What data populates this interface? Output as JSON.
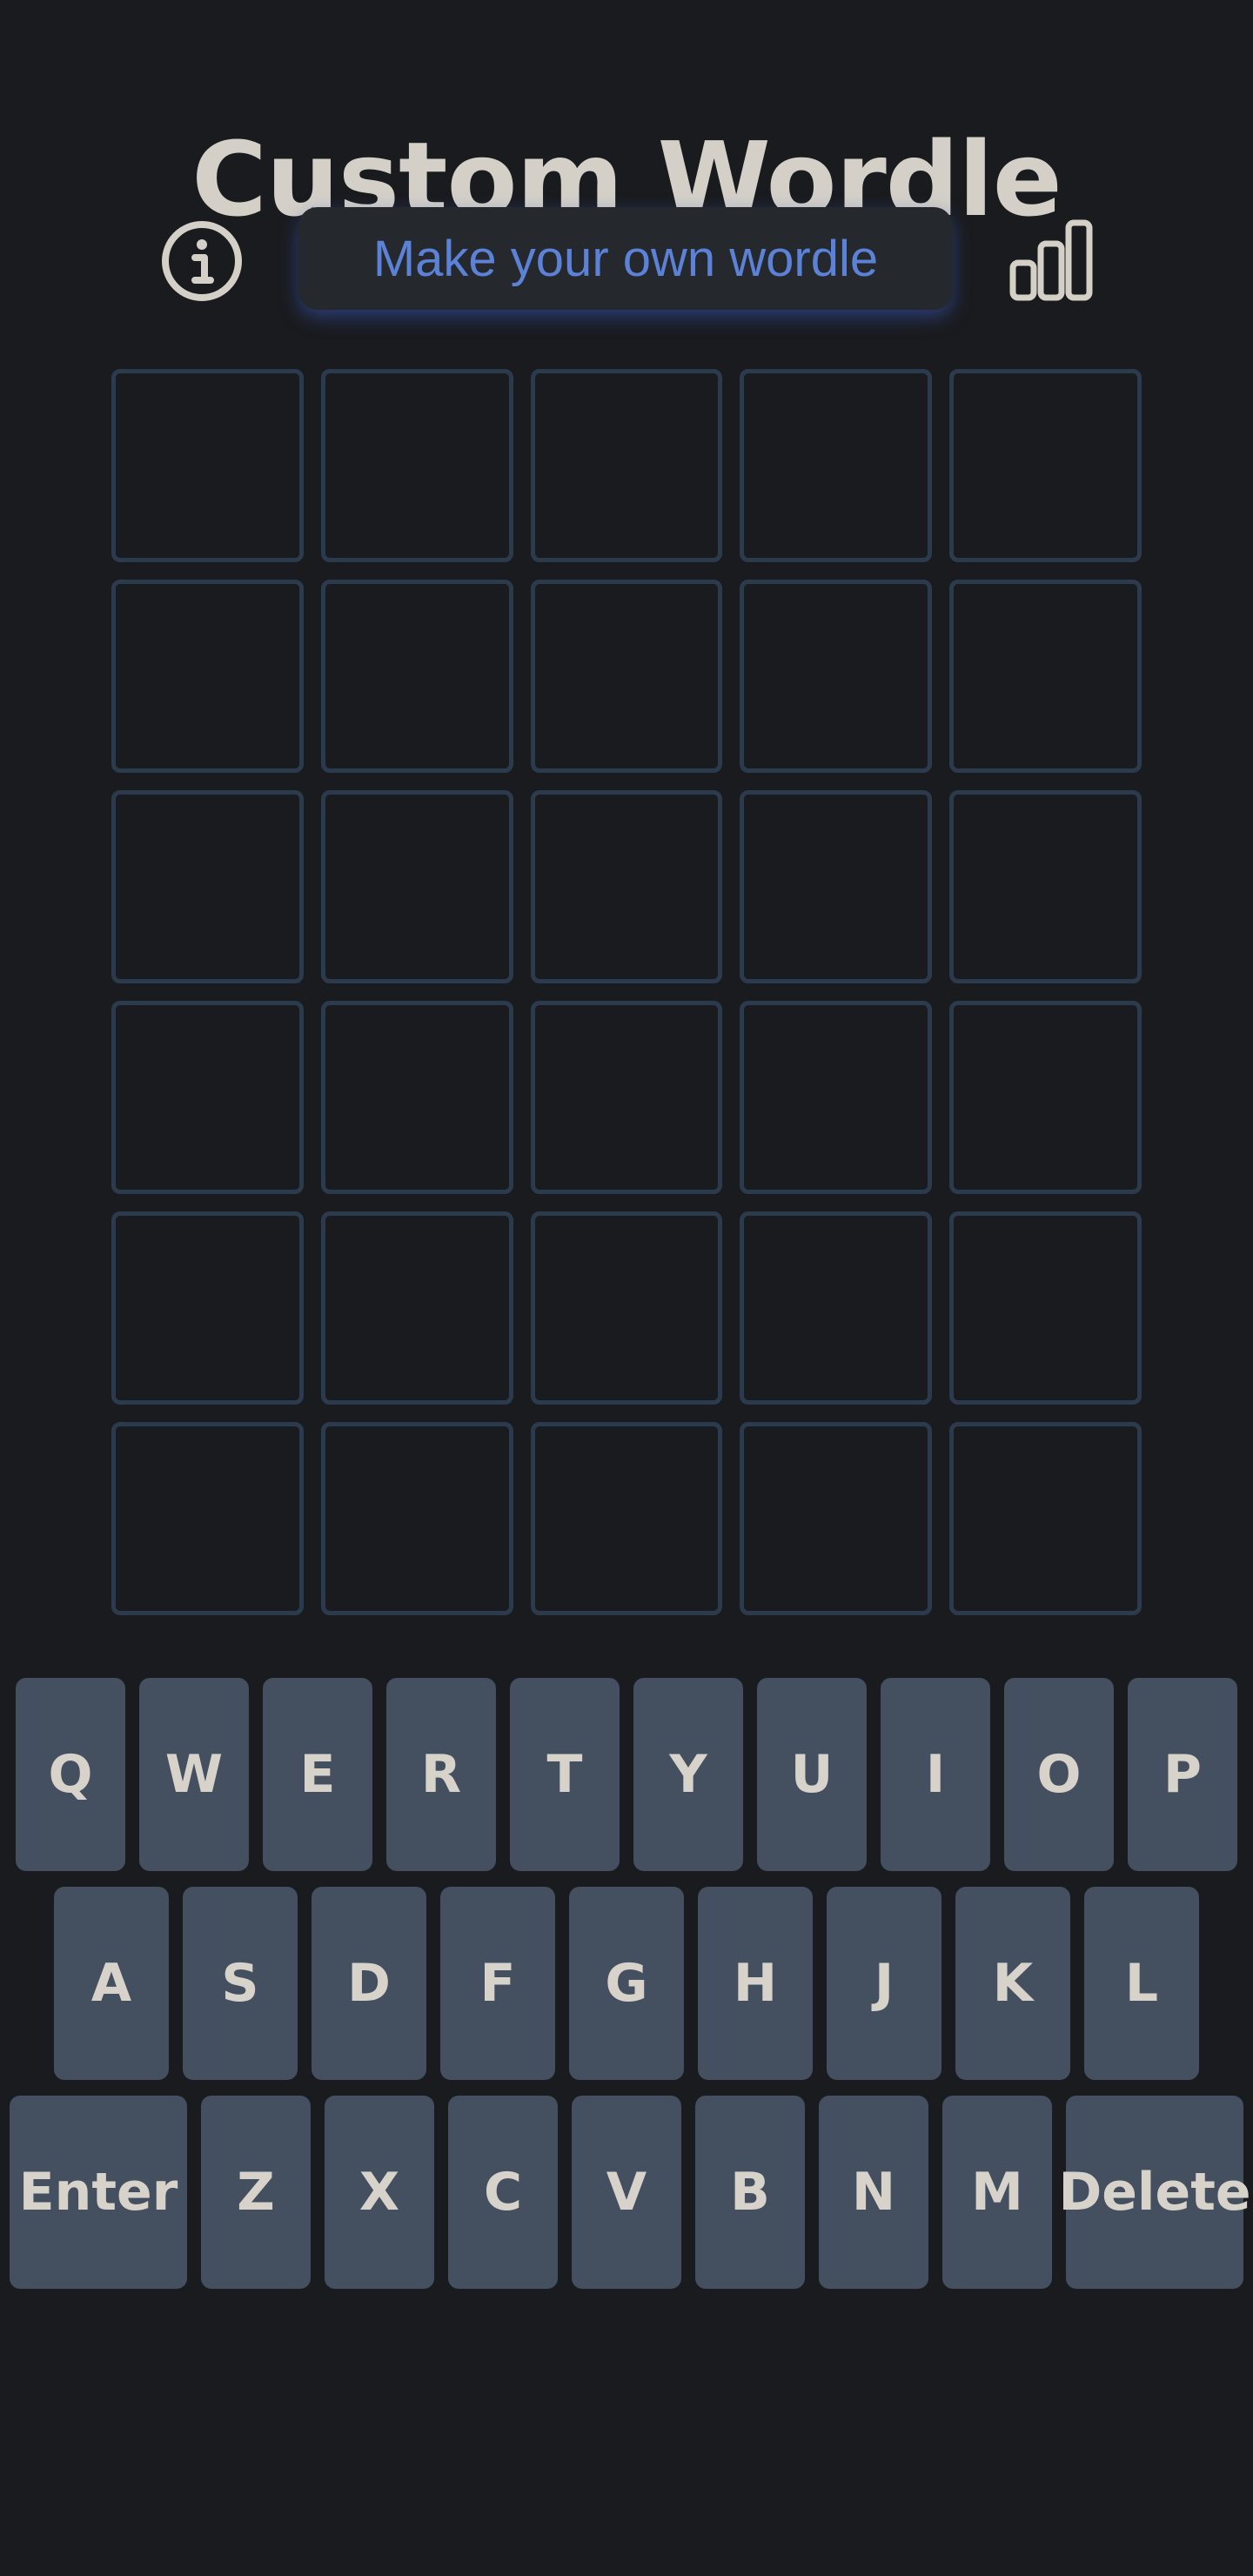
{
  "app": {
    "title": "Custom Wordle"
  },
  "header": {
    "info_icon": "info-circle-icon",
    "make_button_label": "Make your own wordle",
    "stats_icon": "bar-chart-icon"
  },
  "board": {
    "rows": 6,
    "columns": 5,
    "letters": [
      [
        "",
        "",
        "",
        "",
        ""
      ],
      [
        "",
        "",
        "",
        "",
        ""
      ],
      [
        "",
        "",
        "",
        "",
        ""
      ],
      [
        "",
        "",
        "",
        "",
        ""
      ],
      [
        "",
        "",
        "",
        "",
        ""
      ],
      [
        "",
        "",
        "",
        "",
        ""
      ]
    ]
  },
  "keyboard": {
    "rows": [
      [
        "Q",
        "W",
        "E",
        "R",
        "T",
        "Y",
        "U",
        "I",
        "O",
        "P"
      ],
      [
        "A",
        "S",
        "D",
        "F",
        "G",
        "H",
        "J",
        "K",
        "L"
      ],
      [
        "Enter",
        "Z",
        "X",
        "C",
        "V",
        "B",
        "N",
        "M",
        "Delete"
      ]
    ]
  },
  "colors": {
    "background": "#1a1b1e",
    "title": "#d4d0c8",
    "accent": "#5b82d6",
    "tile_border": "#2b3b4d",
    "key_background": "#444f60",
    "key_text": "#d7d3cb"
  }
}
